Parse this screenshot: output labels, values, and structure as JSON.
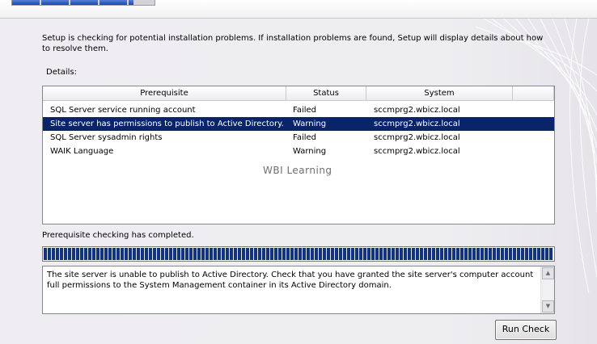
{
  "installer": {
    "intro_text": "Setup is checking for potential installation problems. If installation problems are found, Setup will display details about how to resolve them.",
    "details_label": "Details:",
    "columns": [
      "Prerequisite",
      "Status",
      "System"
    ],
    "rows": [
      {
        "prerequisite": "SQL Server service running account",
        "status": "Failed",
        "system": "sccmprg2.wbicz.local"
      },
      {
        "prerequisite": "Site server has permissions to publish to Active Directory.",
        "status": "Warning",
        "system": "sccmprg2.wbicz.local"
      },
      {
        "prerequisite": "SQL Server sysadmin rights",
        "status": "Failed",
        "system": "sccmprg2.wbicz.local"
      },
      {
        "prerequisite": "WAIK Language",
        "status": "Warning",
        "system": "sccmprg2.wbicz.local"
      }
    ],
    "selected_row_index": 1,
    "watermark": "WBI Learning",
    "progress_label": "Prerequisite checking has completed.",
    "progress_fraction": 1.0,
    "details_text": "The site server is unable to publish to Active Directory.  Check that you have granted the site server's computer account full permissions to the System Management container in its Active Directory domain.",
    "run_check_label": "Run Check"
  },
  "wizard_progress_fraction": 0.85,
  "colors": {
    "selection": "#0a246a",
    "progress": "#13347c",
    "panel": "#eeedf0"
  },
  "icons": [
    "scroll-up-arrow-icon",
    "scroll-down-arrow-icon"
  ]
}
